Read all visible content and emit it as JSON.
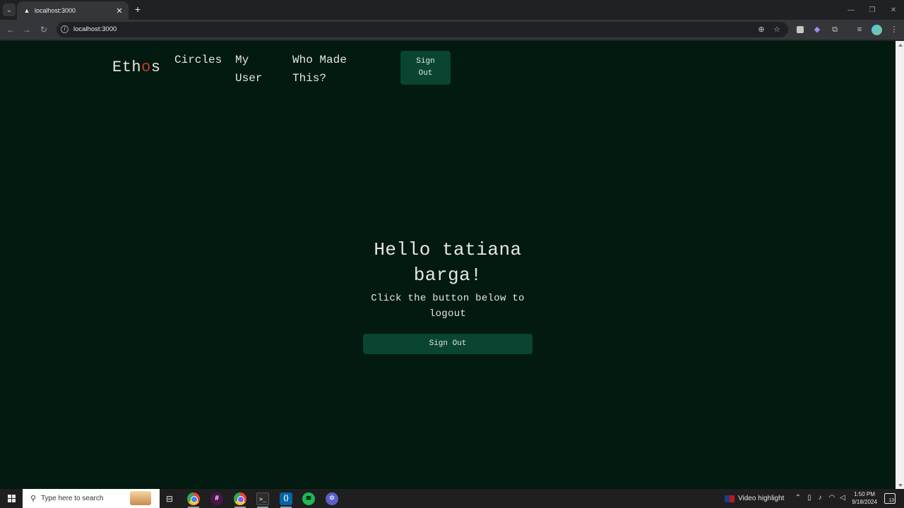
{
  "browser": {
    "tab": {
      "title": "localhost:3000"
    },
    "address_bar": {
      "url": "localhost:3000"
    }
  },
  "page": {
    "brand": {
      "prefix": "Eth",
      "accent": "o",
      "suffix": "s"
    },
    "nav": {
      "circles": "Circles",
      "my_user": "My User",
      "who_made_this": "Who Made This?",
      "sign_out": "Sign Out"
    },
    "greeting": "Hello tatiana barga!",
    "instruction": "Click the button below to logout",
    "sign_out_button": "Sign Out",
    "colors": {
      "background": "#021a0f",
      "button": "#0a4531",
      "accent": "#c0392b",
      "text": "#e6e6e6"
    }
  },
  "taskbar": {
    "search_placeholder": "Type here to search",
    "video_highlight": "Video highlight",
    "time": "1:50 PM",
    "date": "9/18/2024",
    "notification_count": "13",
    "icons": [
      "windows-start-icon",
      "search-icon",
      "task-view-icon",
      "chrome-icon",
      "slack-icon",
      "chrome-profile-icon",
      "terminal-icon",
      "vscode-icon",
      "spotify-icon",
      "app-icon"
    ]
  }
}
